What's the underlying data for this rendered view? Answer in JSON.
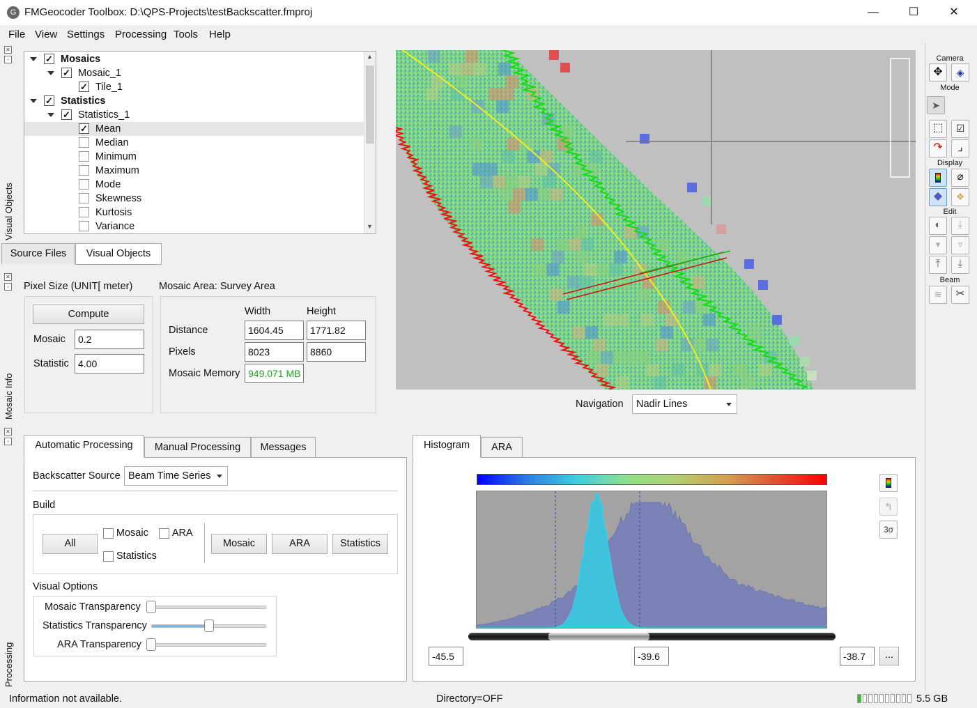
{
  "window": {
    "title": "FMGeocoder Toolbox: D:\\QPS-Projects\\testBackscatter.fmproj",
    "app_icon": "fmgeocoder-app-icon",
    "min_glyph": "—",
    "max_glyph": "☐",
    "close_glyph": "✕"
  },
  "menu": [
    "File",
    "View",
    "Settings",
    "Processing",
    "Tools",
    "Help"
  ],
  "dock_labels": {
    "visual_objects": "Visual Objects",
    "mosaic_info": "Mosaic Info",
    "processing": "Processing"
  },
  "tree": {
    "items": [
      {
        "label": "Mosaics",
        "checked": true,
        "bold": true,
        "level": 0,
        "expander": true
      },
      {
        "label": "Mosaic_1",
        "checked": true,
        "bold": false,
        "level": 1,
        "expander": true
      },
      {
        "label": "Tile_1",
        "checked": true,
        "bold": false,
        "level": 2,
        "expander": false
      },
      {
        "label": "Statistics",
        "checked": true,
        "bold": true,
        "level": 0,
        "expander": true
      },
      {
        "label": "Statistics_1",
        "checked": true,
        "bold": false,
        "level": 1,
        "expander": true
      },
      {
        "label": "Mean",
        "checked": true,
        "bold": false,
        "level": 2,
        "expander": false,
        "selected": true
      },
      {
        "label": "Median",
        "checked": false,
        "bold": false,
        "level": 2,
        "expander": false
      },
      {
        "label": "Minimum",
        "checked": false,
        "bold": false,
        "level": 2,
        "expander": false
      },
      {
        "label": "Maximum",
        "checked": false,
        "bold": false,
        "level": 2,
        "expander": false
      },
      {
        "label": "Mode",
        "checked": false,
        "bold": false,
        "level": 2,
        "expander": false
      },
      {
        "label": "Skewness",
        "checked": false,
        "bold": false,
        "level": 2,
        "expander": false
      },
      {
        "label": "Kurtosis",
        "checked": false,
        "bold": false,
        "level": 2,
        "expander": false
      },
      {
        "label": "Variance",
        "checked": false,
        "bold": false,
        "level": 2,
        "expander": false
      }
    ],
    "scroll_up": "▲",
    "scroll_down": "▼"
  },
  "left_tabs": {
    "source_files": "Source Files",
    "visual_objects": "Visual Objects"
  },
  "mosaic_info": {
    "pixel_size_title": "Pixel Size (UNIT[ meter)",
    "compute_label": "Compute",
    "mosaic_label": "Mosaic",
    "mosaic_value": "0.2",
    "statistic_label": "Statistic",
    "statistic_value": "4.00",
    "area_title": "Mosaic Area:  Survey Area",
    "width_header": "Width",
    "height_header": "Height",
    "distance_label": "Distance",
    "distance_width": "1604.45",
    "distance_height": "1771.82",
    "pixels_label": "Pixels",
    "pixels_width": "8023",
    "pixels_height": "8860",
    "memory_label": "Mosaic Memory",
    "memory_value": "949.071 MB",
    "memory_color": "#1aa01a"
  },
  "navigation": {
    "label": "Navigation",
    "value": "Nadir Lines"
  },
  "processing": {
    "tabs": [
      "Automatic Processing",
      "Manual Processing",
      "Messages"
    ],
    "backscatter_label": "Backscatter Source",
    "backscatter_value": "Beam Time Series",
    "build_label": "Build",
    "all_label": "All",
    "cb_mosaic": "Mosaic",
    "cb_ara": "ARA",
    "cb_statistics": "Statistics",
    "btn_mosaic": "Mosaic",
    "btn_ara": "ARA",
    "btn_statistics": "Statistics",
    "visual_options": "Visual Options",
    "mosaic_transparency": "Mosaic Transparency",
    "statistics_transparency": "Statistics Transparency",
    "ara_transparency": "ARA Transparency",
    "mosaic_transparency_level": 0.0,
    "statistics_transparency_level": 0.5,
    "ara_transparency_level": 0.0
  },
  "histogram": {
    "tabs": [
      "Histogram",
      "ARA"
    ],
    "min_value": "-45.5",
    "mid_value": "-39.6",
    "max_value": "-38.7",
    "more_label": "...",
    "sigma_label": "3σ",
    "colors": {
      "background": "#a3a3a3",
      "wide": "#7b82b6",
      "narrow": "#3fc3dc"
    }
  },
  "toolbar": {
    "camera": "Camera",
    "mode": "Mode",
    "display": "Display",
    "edit": "Edit",
    "beam": "Beam"
  },
  "status": {
    "left": "Information not available.",
    "center": "Directory=OFF",
    "memory": "5.5 GB",
    "memory_fill_fraction": 0.1
  }
}
